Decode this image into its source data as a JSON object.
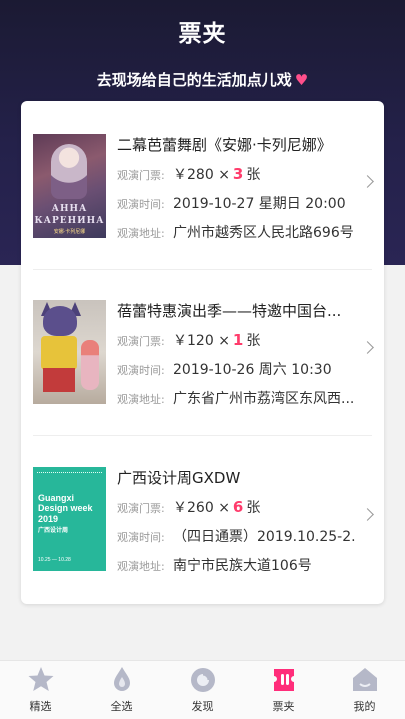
{
  "header": {
    "title": "票夹",
    "subtitle": "去现场给自己的生活加点儿戏",
    "subtitle_icon": "heart-icon"
  },
  "tickets": [
    {
      "title": "二幕芭蕾舞剧《安娜·卡列尼娜》",
      "price_label": "观演门票:",
      "price": "￥280",
      "times": "×",
      "quantity": "3",
      "unit": "张",
      "time_label": "观演时间:",
      "time": "2019-10-27 星期日 20:00",
      "address_label": "观演地址:",
      "address": "广州市越秀区人民北路696号",
      "poster_lines": [
        "АННА",
        "КАРЕНИНА",
        "安娜·卡列尼娜"
      ]
    },
    {
      "title": "蓓蕾特惠演出季——特邀中国台...",
      "price_label": "观演门票:",
      "price": "￥120",
      "times": "×",
      "quantity": "1",
      "unit": "张",
      "time_label": "观演时间:",
      "time": "2019-10-26 周六 10:30",
      "address_label": "观演地址:",
      "address": "广东省广州市荔湾区东风西..."
    },
    {
      "title": "广西设计周GXDW",
      "price_label": "观演门票:",
      "price": "￥260",
      "times": "×",
      "quantity": "6",
      "unit": "张",
      "time_label": "观演时间:",
      "time": "（四日通票）2019.10.25-2...",
      "address_label": "观演地址:",
      "address": "南宁市民族大道106号",
      "poster_lines": [
        "Guangxi",
        "Design week",
        "2019",
        "广西设计周",
        "10.25 — 10.28"
      ]
    }
  ],
  "tabbar": {
    "items": [
      {
        "label": "精选",
        "icon": "star-icon"
      },
      {
        "label": "全选",
        "icon": "drop-icon"
      },
      {
        "label": "发现",
        "icon": "discover-icon"
      },
      {
        "label": "票夹",
        "icon": "ticket-icon",
        "active": true
      },
      {
        "label": "我的",
        "icon": "home-icon"
      }
    ]
  },
  "colors": {
    "header_bg": "#1f1d3d",
    "accent": "#ff3b6b",
    "active_tab": "#ff2d7a",
    "inactive_tab": "#b5b8c8"
  }
}
